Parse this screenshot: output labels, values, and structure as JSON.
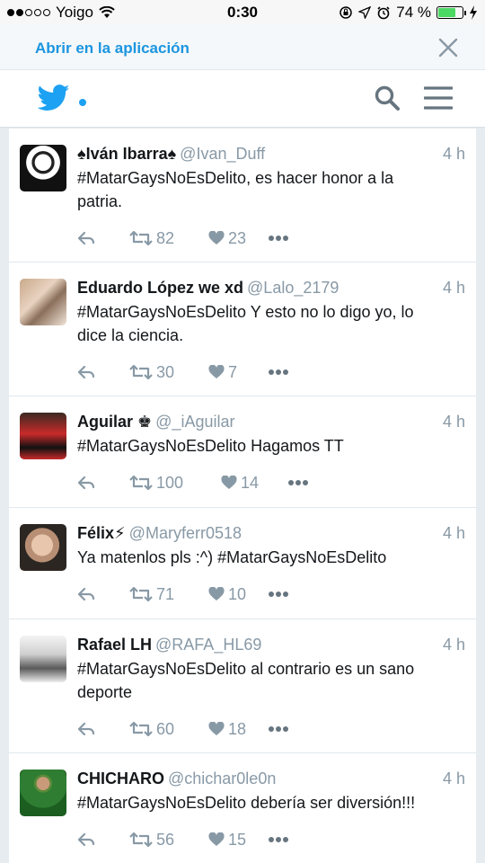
{
  "status_bar": {
    "carrier": "Yoigo",
    "time": "0:30",
    "battery": "74 %",
    "battery_level": 0.74,
    "signal_bars_filled": 2,
    "signal_bars_total": 5,
    "icons": [
      "wifi-icon",
      "rotation-lock-icon",
      "location-icon",
      "alarm-icon",
      "battery-icon",
      "charging-icon"
    ]
  },
  "banner": {
    "open_in_app": "Abrir en la aplicación",
    "close_icon": "close-icon"
  },
  "nav": {
    "logo_icon": "twitter-bird-icon",
    "search_icon": "search-icon",
    "menu_icon": "hamburger-menu-icon",
    "accent": "#1da1f2"
  },
  "tweets": [
    {
      "name": "♠Iván Ibarra♠",
      "handle": "@Ivan_Duff",
      "time": "4 h",
      "lines": [
        "#MatarGaysNoEsDelito, es hacer honor a la",
        "patria."
      ],
      "retweets": "82",
      "likes": "23"
    },
    {
      "name": "Eduardo López we xd",
      "handle": "@Lalo_2179",
      "time": "4 h",
      "lines": [
        "#MatarGaysNoEsDelito Y esto no lo digo yo, lo",
        "dice la ciencia."
      ],
      "retweets": "30",
      "likes": "7"
    },
    {
      "name": "Aguilar ♚",
      "handle": "@_iAguilar",
      "time": "4 h",
      "lines": [
        "#MatarGaysNoEsDelito Hagamos TT"
      ],
      "retweets": "100",
      "likes": "14"
    },
    {
      "name": "Félix⚡",
      "handle": "@Maryferr0518",
      "time": "4 h",
      "lines": [
        "Ya matenlos pls :^) #MatarGaysNoEsDelito"
      ],
      "retweets": "71",
      "likes": "10"
    },
    {
      "name": "Rafael LH",
      "handle": "@RAFA_HL69",
      "time": "4 h",
      "lines": [
        "#MatarGaysNoEsDelito al contrario es un sano",
        "deporte"
      ],
      "retweets": "60",
      "likes": "18"
    },
    {
      "name": "CHICHARO",
      "handle": "@chichar0le0n",
      "time": "4 h",
      "lines": [
        "#MatarGaysNoEsDelito debería ser diversión!!!"
      ],
      "retweets": "56",
      "likes": "15"
    }
  ]
}
